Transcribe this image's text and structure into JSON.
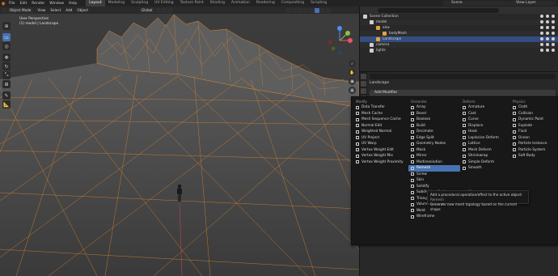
{
  "topbar": {
    "menus": [
      "File",
      "Edit",
      "Render",
      "Window",
      "Help"
    ],
    "workspaces": [
      "Layout",
      "Modeling",
      "Sculpting",
      "UV Editing",
      "Texture Paint",
      "Shading",
      "Animation",
      "Rendering",
      "Compositing",
      "Scripting"
    ],
    "active_workspace": "Layout",
    "scene": "Scene",
    "view_layer": "View Layer"
  },
  "viewport": {
    "mode": "Object Mode",
    "menus": [
      "View",
      "Select",
      "Add",
      "Object"
    ],
    "transform": "Global",
    "info_line1": "User Perspective",
    "info_line2": "(1) model | Landscape",
    "tools": [
      "cursor-icon",
      "move-icon",
      "rotate-icon",
      "scale-icon",
      "transform-icon",
      "annotate-icon",
      "measure-icon"
    ],
    "gizmo": {
      "x_color": "#f35166",
      "y_color": "#8bc24a",
      "z_color": "#4a8ff3"
    }
  },
  "outliner": {
    "rows": [
      {
        "label": "Scene Collection",
        "indent": 0,
        "icon_color": "#cfcfcf",
        "selected": false,
        "extra": ""
      },
      {
        "label": "model",
        "indent": 1,
        "icon_color": "#cfcfcf",
        "selected": false,
        "extra": ""
      },
      {
        "label": "alex",
        "indent": 2,
        "icon_color": "#e6a23c",
        "selected": false,
        "extra": ""
      },
      {
        "label": "bodyMesh",
        "indent": 3,
        "icon_color": "#e6a23c",
        "selected": false,
        "extra": ""
      },
      {
        "label": "Landscape",
        "indent": 2,
        "icon_color": "#e6a23c",
        "selected": true,
        "extra": ""
      },
      {
        "label": "camera",
        "indent": 1,
        "icon_color": "#cfcfcf",
        "selected": false,
        "extra": ""
      },
      {
        "label": "lights",
        "indent": 1,
        "icon_color": "#cfcfcf",
        "selected": false,
        "extra": ""
      }
    ]
  },
  "properties": {
    "object_name": "Landscape",
    "add_modifier": "Add Modifier"
  },
  "modifier_menu": {
    "columns": [
      {
        "title": "Modify",
        "items": [
          "Data Transfer",
          "Mesh Cache",
          "Mesh Sequence Cache",
          "Normal Edit",
          "Weighted Normal",
          "UV Project",
          "UV Warp",
          "Vertex Weight Edit",
          "Vertex Weight Mix",
          "Vertex Weight Proximity"
        ]
      },
      {
        "title": "Generate",
        "items": [
          "Array",
          "Bevel",
          "Boolean",
          "Build",
          "Decimate",
          "Edge Split",
          "Geometry Nodes",
          "Mask",
          "Mirror",
          "Multiresolution",
          "Remesh",
          "Screw",
          "Skin",
          "Solidify",
          "Subdivision Surface",
          "Triangulate",
          "Volume to Mesh",
          "Weld",
          "Wireframe"
        ]
      },
      {
        "title": "Deform",
        "items": [
          "Armature",
          "Cast",
          "Curve",
          "Displace",
          "Hook",
          "Laplacian Deform",
          "Lattice",
          "Mesh Deform",
          "Shrinkwrap",
          "Simple Deform",
          "Smooth",
          "",
          "",
          "",
          "Warp",
          "Wave"
        ]
      },
      {
        "title": "Physics",
        "items": [
          "Cloth",
          "Collision",
          "Dynamic Paint",
          "Explode",
          "Fluid",
          "Ocean",
          "Particle Instance",
          "Particle System",
          "Soft Body"
        ]
      }
    ],
    "highlighted": "Remesh",
    "tooltip_line1": "Add a procedural operation/effect to the active object:",
    "tooltip_line1_tail": "Remesh",
    "tooltip_line2": "Generate new mesh topology based on the current shape"
  },
  "colors": {
    "accent": "#4772b3",
    "wire": "#e8892a",
    "ground": "#3a3a3a"
  }
}
